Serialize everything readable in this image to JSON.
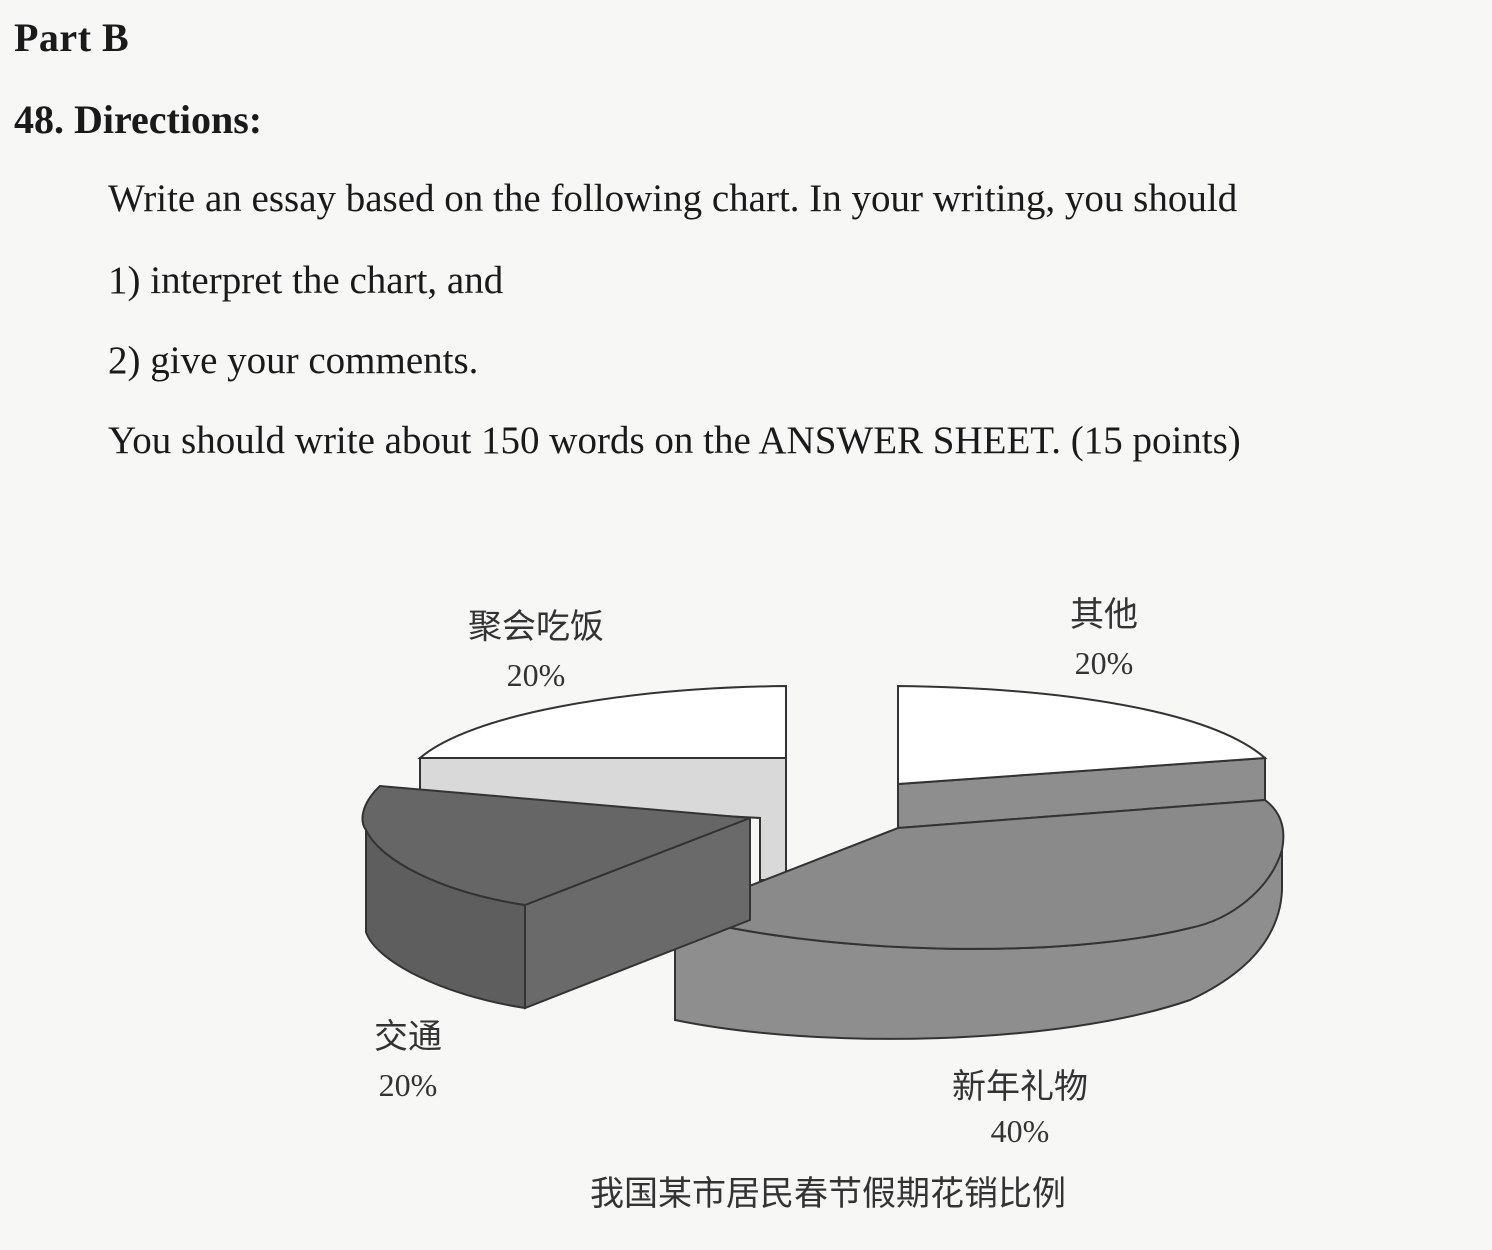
{
  "heading": {
    "part": "Part B",
    "question_number": "48.",
    "title": "Directions",
    "title_colon": ":"
  },
  "instructions": {
    "line1": "Write an essay based on the following chart. In your writing, you should",
    "line2": "1) interpret the chart, and",
    "line3": "2) give your comments.",
    "line4": "You should write about 150 words on the ANSWER SHEET. (15 points)"
  },
  "chart_data": {
    "type": "pie",
    "style": "3d-exploded",
    "title": "我国某市居民春节假期花销比例",
    "slices": [
      {
        "label": "聚会吃饭",
        "value": 20,
        "display": "20%",
        "color": "#ffffff"
      },
      {
        "label": "其他",
        "value": 20,
        "display": "20%",
        "color": "#ffffff"
      },
      {
        "label": "新年礼物",
        "value": 40,
        "display": "40%",
        "color": "#8e8e8e"
      },
      {
        "label": "交通",
        "value": 20,
        "display": "20%",
        "color": "#5e5e5e"
      }
    ]
  }
}
